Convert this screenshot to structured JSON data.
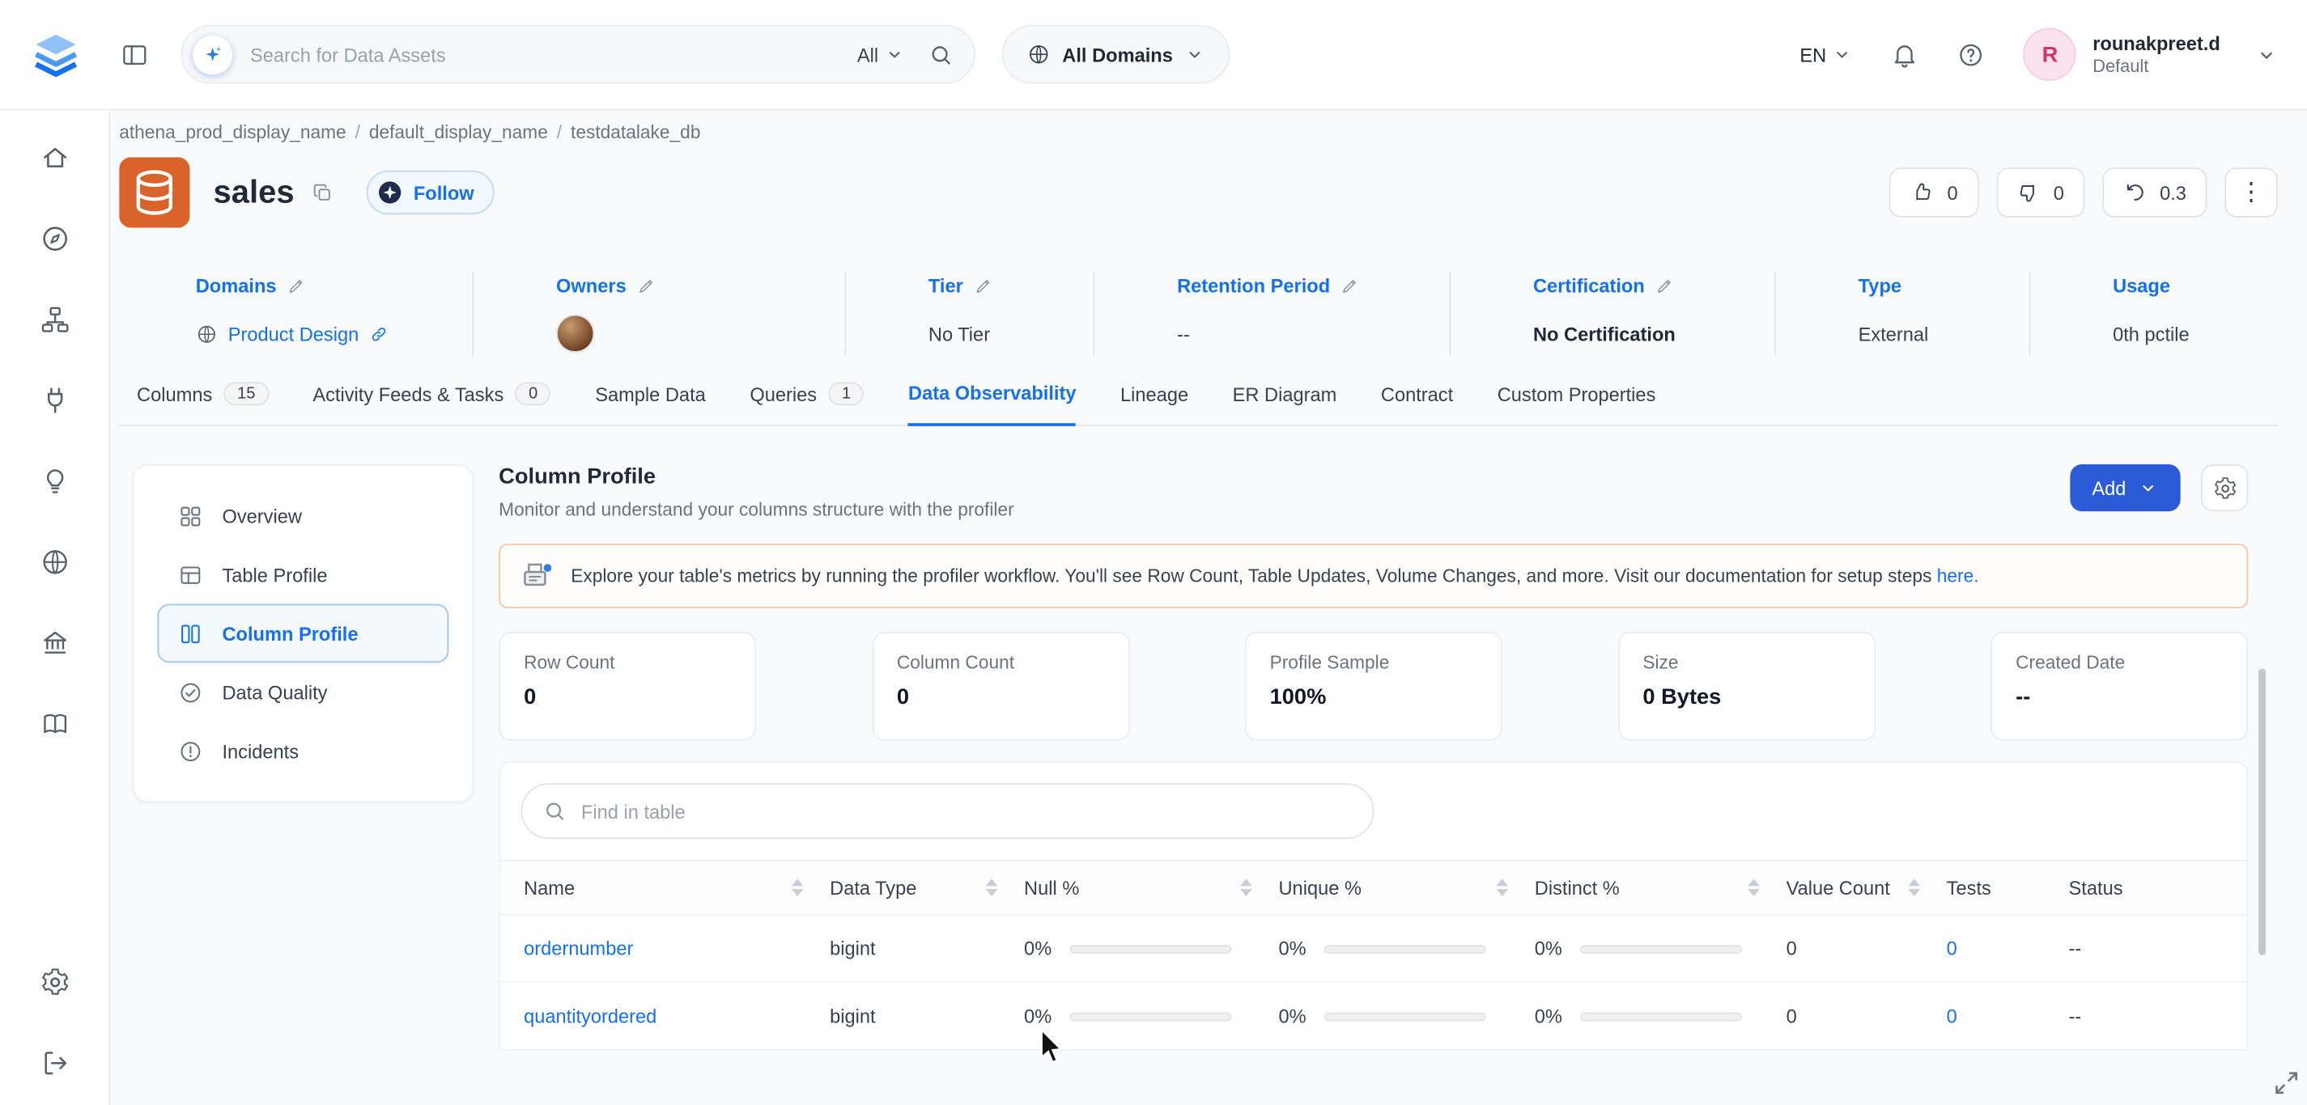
{
  "colors": {
    "accent": "#1570ef",
    "primary_button": "#2b5bd7",
    "entity_icon_orange": "#d9632b",
    "banner_border": "#f3c8a2",
    "avatar_bg": "#fbe3ee",
    "avatar_text": "#d6336c"
  },
  "topbar": {
    "search_placeholder": "Search for Data Assets",
    "search_scope": "All",
    "domains_label": "All Domains",
    "language": "EN",
    "user": {
      "name": "rounakpreet.d",
      "team": "Default",
      "initial": "R"
    }
  },
  "breadcrumb": {
    "separator": "/",
    "items": [
      "athena_prod_display_name",
      "default_display_name",
      "testdatalake_db"
    ]
  },
  "entity": {
    "title": "sales",
    "follow_label": "Follow",
    "upvotes": "0",
    "downvotes": "0",
    "version": "0.3"
  },
  "metadata": [
    {
      "label": "Domains",
      "value": "Product Design"
    },
    {
      "label": "Owners",
      "value": ""
    },
    {
      "label": "Tier",
      "value": "No Tier"
    },
    {
      "label": "Retention Period",
      "value": "--"
    },
    {
      "label": "Certification",
      "value": "No Certification"
    },
    {
      "label": "Type",
      "value": "External"
    },
    {
      "label": "Usage",
      "value": "0th pctile"
    }
  ],
  "tabs": [
    {
      "label": "Columns",
      "count": "15"
    },
    {
      "label": "Activity Feeds & Tasks",
      "count": "0"
    },
    {
      "label": "Sample Data"
    },
    {
      "label": "Queries",
      "count": "1"
    },
    {
      "label": "Data Observability"
    },
    {
      "label": "Lineage"
    },
    {
      "label": "ER Diagram"
    },
    {
      "label": "Contract"
    },
    {
      "label": "Custom Properties"
    }
  ],
  "profile_nav": [
    {
      "label": "Overview"
    },
    {
      "label": "Table Profile"
    },
    {
      "label": "Column Profile"
    },
    {
      "label": "Data Quality"
    },
    {
      "label": "Incidents"
    }
  ],
  "main": {
    "title": "Column Profile",
    "subtitle": "Monitor and understand your columns structure with the profiler",
    "add_label": "Add",
    "banner": {
      "text": "Explore your table's metrics by running the profiler workflow. You'll see Row Count, Table Updates, Volume Changes, and more. Visit our documentation for setup steps ",
      "link_label": "here."
    },
    "stats": [
      {
        "label": "Row Count",
        "value": "0"
      },
      {
        "label": "Column Count",
        "value": "0"
      },
      {
        "label": "Profile Sample",
        "value": "100%"
      },
      {
        "label": "Size",
        "value": "0 Bytes"
      },
      {
        "label": "Created Date",
        "value": "--"
      }
    ],
    "find_placeholder": "Find in table",
    "table": {
      "headers": [
        "Name",
        "Data Type",
        "Null %",
        "Unique %",
        "Distinct %",
        "Value Count",
        "Tests",
        "Status"
      ],
      "rows": [
        {
          "name": "ordernumber",
          "data_type": "bigint",
          "null_pct": "0%",
          "unique_pct": "0%",
          "distinct_pct": "0%",
          "value_count": "0",
          "tests": "0",
          "status": "--"
        },
        {
          "name": "quantityordered",
          "data_type": "bigint",
          "null_pct": "0%",
          "unique_pct": "0%",
          "distinct_pct": "0%",
          "value_count": "0",
          "tests": "0",
          "status": "--"
        }
      ]
    }
  }
}
